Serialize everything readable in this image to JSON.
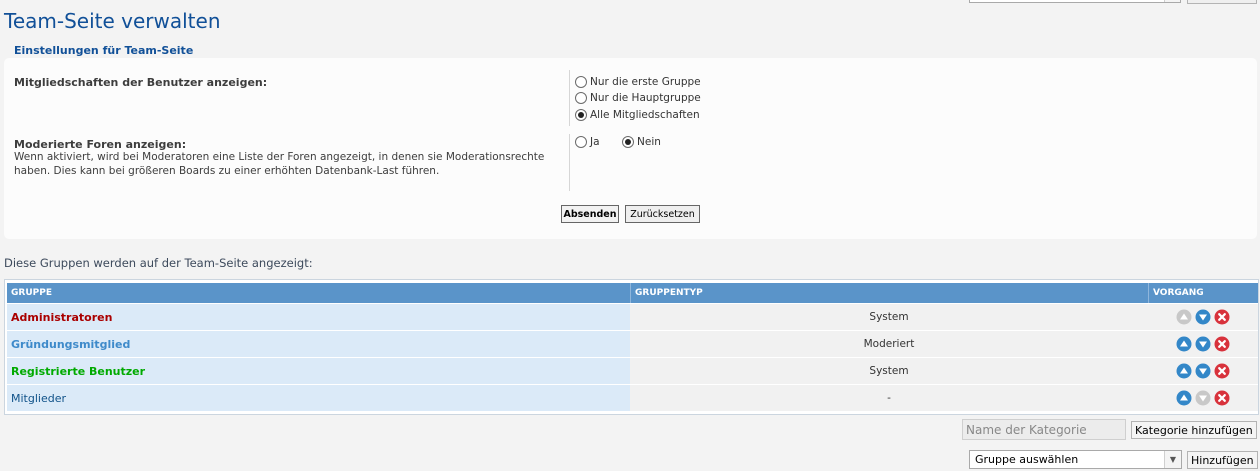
{
  "page": {
    "title": "Team-Seite verwalten"
  },
  "settings": {
    "fieldset_title": "Einstellungen für Team-Seite",
    "memberships": {
      "label": "Mitgliedschaften der Benutzer anzeigen:",
      "options": [
        "Nur die erste Gruppe",
        "Nur die Hauptgruppe",
        "Alle Mitgliedschaften"
      ],
      "selected": "Alle Mitgliedschaften"
    },
    "moderated_forums": {
      "label": "Moderierte Foren anzeigen:",
      "description": "Wenn aktiviert, wird bei Moderatoren eine Liste der Foren angezeigt, in denen sie Moderationsrechte haben. Dies kann bei größeren Boards zu einer erhöhten Datenbank-Last führen.",
      "options": [
        "Ja",
        "Nein"
      ],
      "selected": "Nein"
    },
    "submit_label": "Absenden",
    "reset_label": "Zurücksetzen"
  },
  "groups_section": {
    "intro": "Diese Gruppen werden auf der Team-Seite angezeigt:",
    "columns": [
      "GRUPPE",
      "GRUPPENTYP",
      "VORGANG"
    ],
    "rows": [
      {
        "name": "Administratoren",
        "type": "System",
        "color": "#AA0000",
        "up_enabled": false,
        "down_enabled": true
      },
      {
        "name": "Gründungsmitglied",
        "type": "Moderiert",
        "color": "#3E8ACA",
        "up_enabled": true,
        "down_enabled": true
      },
      {
        "name": "Registrierte Benutzer",
        "type": "System",
        "color": "#00AA00",
        "up_enabled": true,
        "down_enabled": true
      },
      {
        "name": "Mitglieder",
        "type": "-",
        "color": "#105289",
        "up_enabled": true,
        "down_enabled": false
      }
    ]
  },
  "category": {
    "placeholder": "Name der Kategorie",
    "add_label": "Kategorie hinzufügen"
  },
  "group_add": {
    "selected": "Gruppe auswählen",
    "add_label": "Hinzufügen"
  },
  "colors": {
    "header_bg": "#5A94C9",
    "title": "#115098",
    "delete": "#D8323C",
    "move": "#3387C8"
  }
}
